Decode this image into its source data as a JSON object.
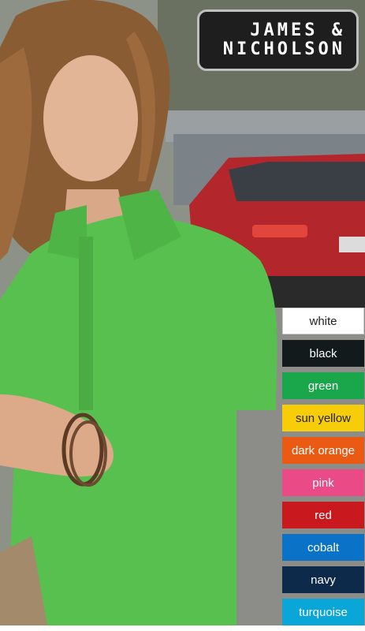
{
  "brand": {
    "line1": "JAMES &",
    "line2": "NICHOLSON"
  },
  "colors": [
    {
      "label": "white",
      "bg": "#ffffff",
      "fg": "#222222",
      "border": "#cccccc"
    },
    {
      "label": "black",
      "bg": "#121a1c",
      "fg": "#ffffff"
    },
    {
      "label": "green",
      "bg": "#1aa64a",
      "fg": "#ffffff"
    },
    {
      "label": "sun yellow",
      "bg": "#f7cc08",
      "fg": "#222222"
    },
    {
      "label": "dark orange",
      "bg": "#ea5a12",
      "fg": "#ffffff"
    },
    {
      "label": "pink",
      "bg": "#ea4a86",
      "fg": "#ffffff"
    },
    {
      "label": "red",
      "bg": "#c81a1e",
      "fg": "#ffffff"
    },
    {
      "label": "cobalt",
      "bg": "#0a73c8",
      "fg": "#ffffff"
    },
    {
      "label": "navy",
      "bg": "#0e2a4a",
      "fg": "#ffffff"
    },
    {
      "label": "turquoise",
      "bg": "#0aa6d8",
      "fg": "#ffffff"
    }
  ]
}
